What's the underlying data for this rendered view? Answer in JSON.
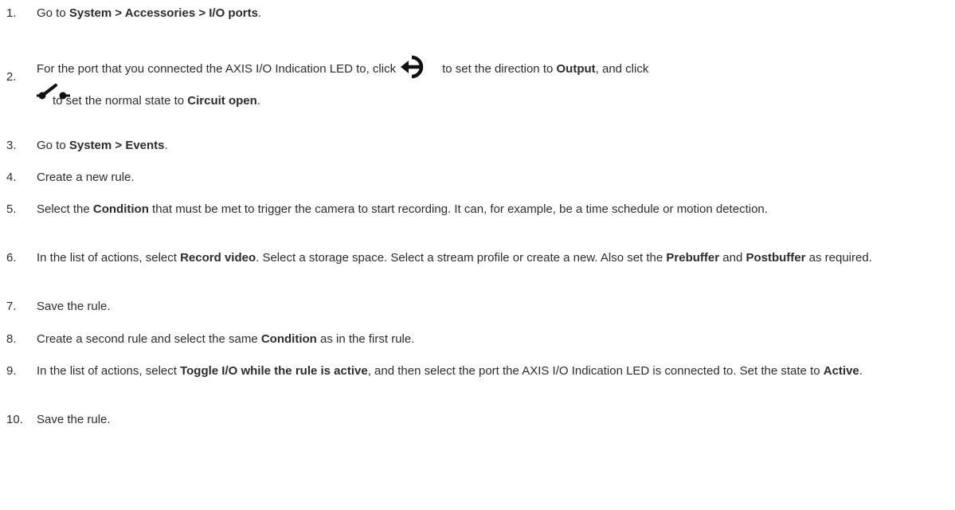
{
  "steps": [
    {
      "num": "1.",
      "parts": [
        "Go to ",
        "System > Accessories > I/O ports",
        "."
      ]
    },
    {
      "num": "2.",
      "line1_parts": [
        "For the port that you connected the AXIS I/O Indication LED to, click",
        "to set the direction to ",
        "Output",
        ", and click"
      ],
      "line2_parts": [
        "to set the normal state to ",
        "Circuit open",
        "."
      ],
      "icons": [
        "direction-toggle-icon",
        "circuit-state-icon"
      ]
    },
    {
      "num": "3.",
      "parts": [
        "Go to ",
        "System > Events",
        "."
      ]
    },
    {
      "num": "4.",
      "parts": [
        "Create a new rule."
      ]
    },
    {
      "num": "5.",
      "parts": [
        "Select the ",
        "Condition",
        " that must be met to trigger the camera to start recording. It can, for example, be a time schedule or motion detection."
      ]
    },
    {
      "num": "6.",
      "parts": [
        "In the list of actions, select ",
        "Record video",
        ". Select a storage space. Select a stream profile or create a new. Also set the ",
        "Prebuffer",
        " and ",
        "Postbuffer",
        " as required."
      ]
    },
    {
      "num": "7.",
      "parts": [
        "Save the rule."
      ]
    },
    {
      "num": "8.",
      "parts": [
        "Create a second rule and select the same ",
        "Condition",
        " as in the first rule."
      ]
    },
    {
      "num": "9.",
      "parts": [
        "In the list of actions, select ",
        "Toggle I/O while the rule is active",
        ", and then select the port the AXIS I/O Indication LED is connected to. Set the state to ",
        "Active",
        "."
      ]
    },
    {
      "num": "10.",
      "parts": [
        "Save the rule."
      ]
    }
  ]
}
